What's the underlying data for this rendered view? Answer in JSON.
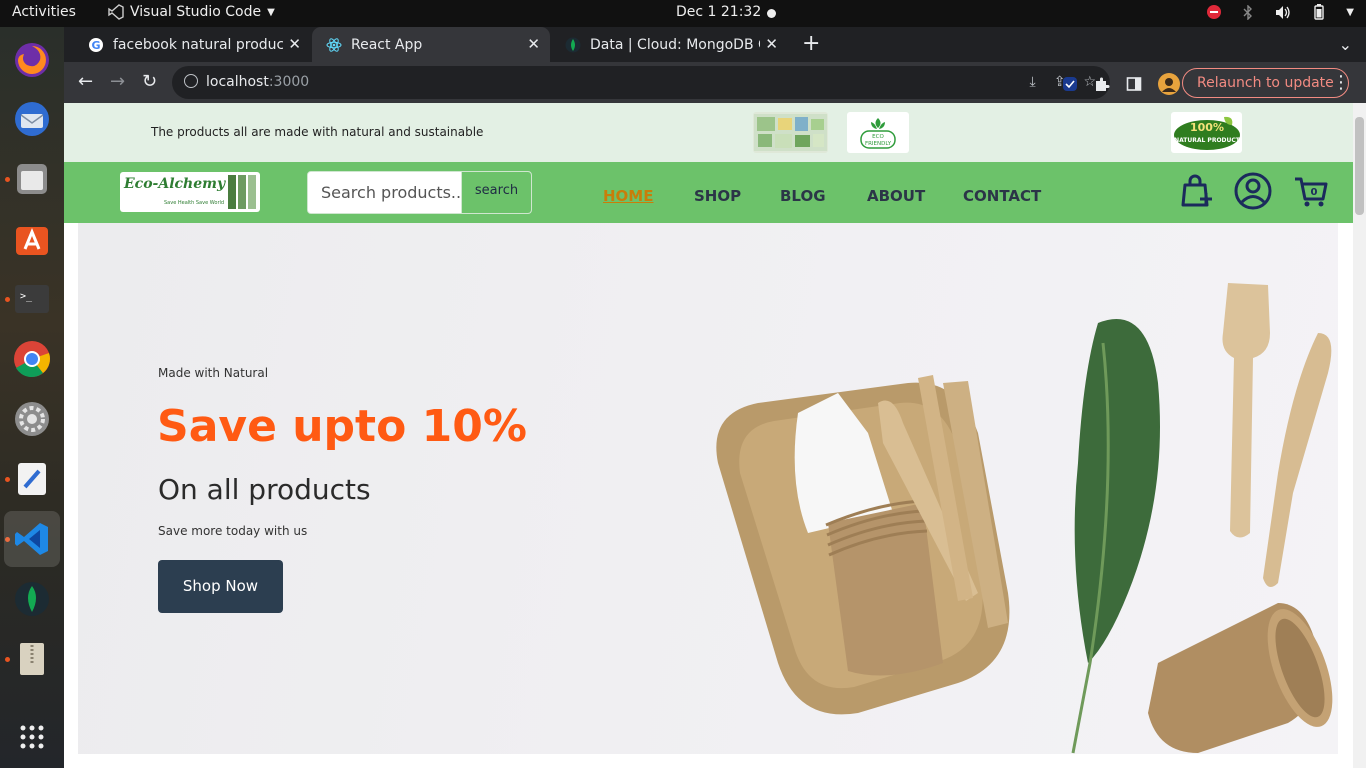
{
  "system": {
    "activities": "Activities",
    "app_name": "Visual Studio Code",
    "clock": "Dec 1  21:32"
  },
  "browser": {
    "tabs": [
      {
        "title": "facebook natural produc",
        "icon": "google-icon"
      },
      {
        "title": "React App",
        "icon": "react-icon"
      },
      {
        "title": "Data | Cloud: MongoDB C",
        "icon": "mongodb-icon"
      }
    ],
    "url_host": "localhost",
    "url_port": ":3000",
    "relaunch_label": "Relaunch to update"
  },
  "site": {
    "promo_text": "The products all are made with natural and sustainable",
    "badges": {
      "eco_friendly": "ECO FRIENDLY",
      "natural_top": "100%",
      "natural_bottom": "NATURAL PRODUCT"
    },
    "logo": {
      "name": "Eco-Alchemy",
      "tagline": "Save Health Save World"
    },
    "search": {
      "placeholder": "Search products...",
      "button": "search"
    },
    "menu": [
      "HOME",
      "SHOP",
      "BLOG",
      "ABOUT",
      "CONTACT"
    ],
    "cart_count": "0",
    "hero": {
      "eyebrow": "Made with Natural",
      "headline": "Save upto 10%",
      "subheadline": "On all products",
      "small_text": "Save more today with us",
      "cta": "Shop Now"
    }
  },
  "colors": {
    "nav_green": "#6cc26a",
    "promo_bg": "#e3f0e4",
    "headline_orange": "#ff5a13",
    "active_menu": "#c97d0a",
    "button_dark": "#2c3e50"
  }
}
